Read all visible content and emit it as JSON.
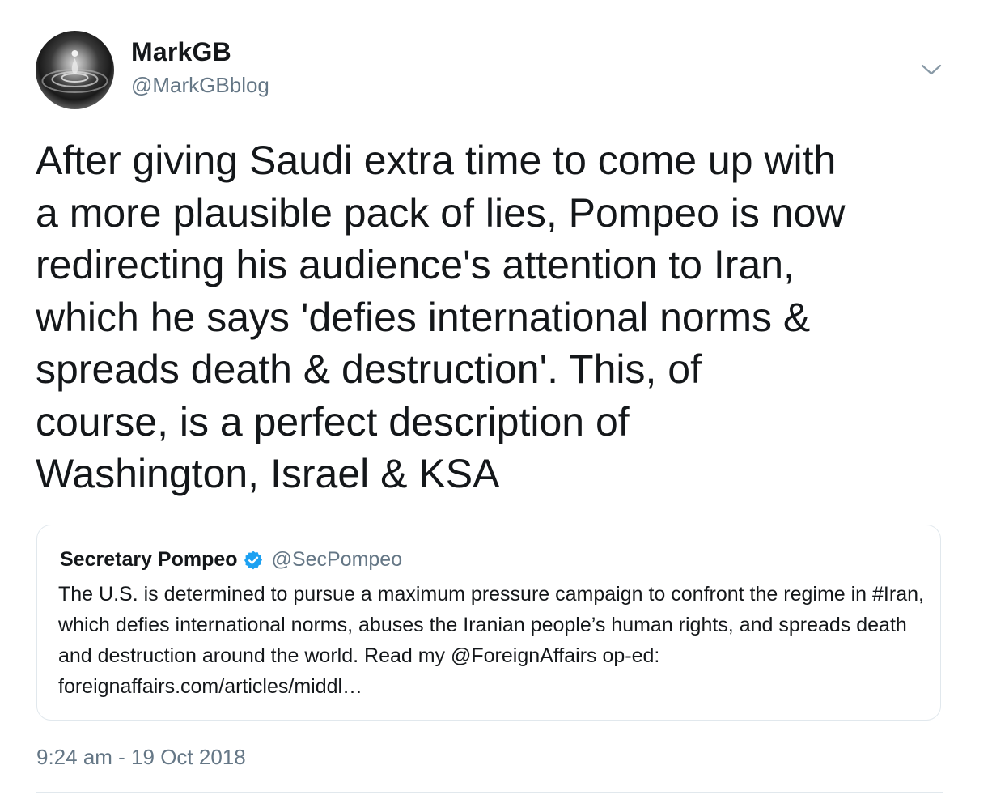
{
  "author": {
    "display_name": "MarkGB",
    "handle": "@MarkGBblog",
    "avatar_icon": "water-drop-avatar"
  },
  "menu_icon": "chevron-down-icon",
  "tweet": {
    "text": "After giving Saudi extra time to come up with\na more plausible pack of lies, Pompeo is now\nredirecting his audience's attention to Iran,\nwhich he says 'defies international norms &\nspreads death & destruction'. This, of\ncourse, is a perfect description of\nWashington, Israel & KSA"
  },
  "quoted_tweet": {
    "display_name": "Secretary Pompeo",
    "verified_icon": "verified-badge-icon",
    "handle": "@SecPompeo",
    "text": "The U.S. is determined to pursue a maximum pressure campaign to confront the regime in #Iran, which defies international norms, abuses the Iranian people’s human rights, and spreads death and destruction around the world. Read my @ForeignAffairs op-ed: foreignaffairs.com/articles/middl…"
  },
  "timestamp": "9:24 am - 19 Oct 2018",
  "colors": {
    "text_primary": "#14171a",
    "text_secondary": "#657786",
    "border": "#e1e8ed",
    "verified_blue": "#1da1f2"
  }
}
